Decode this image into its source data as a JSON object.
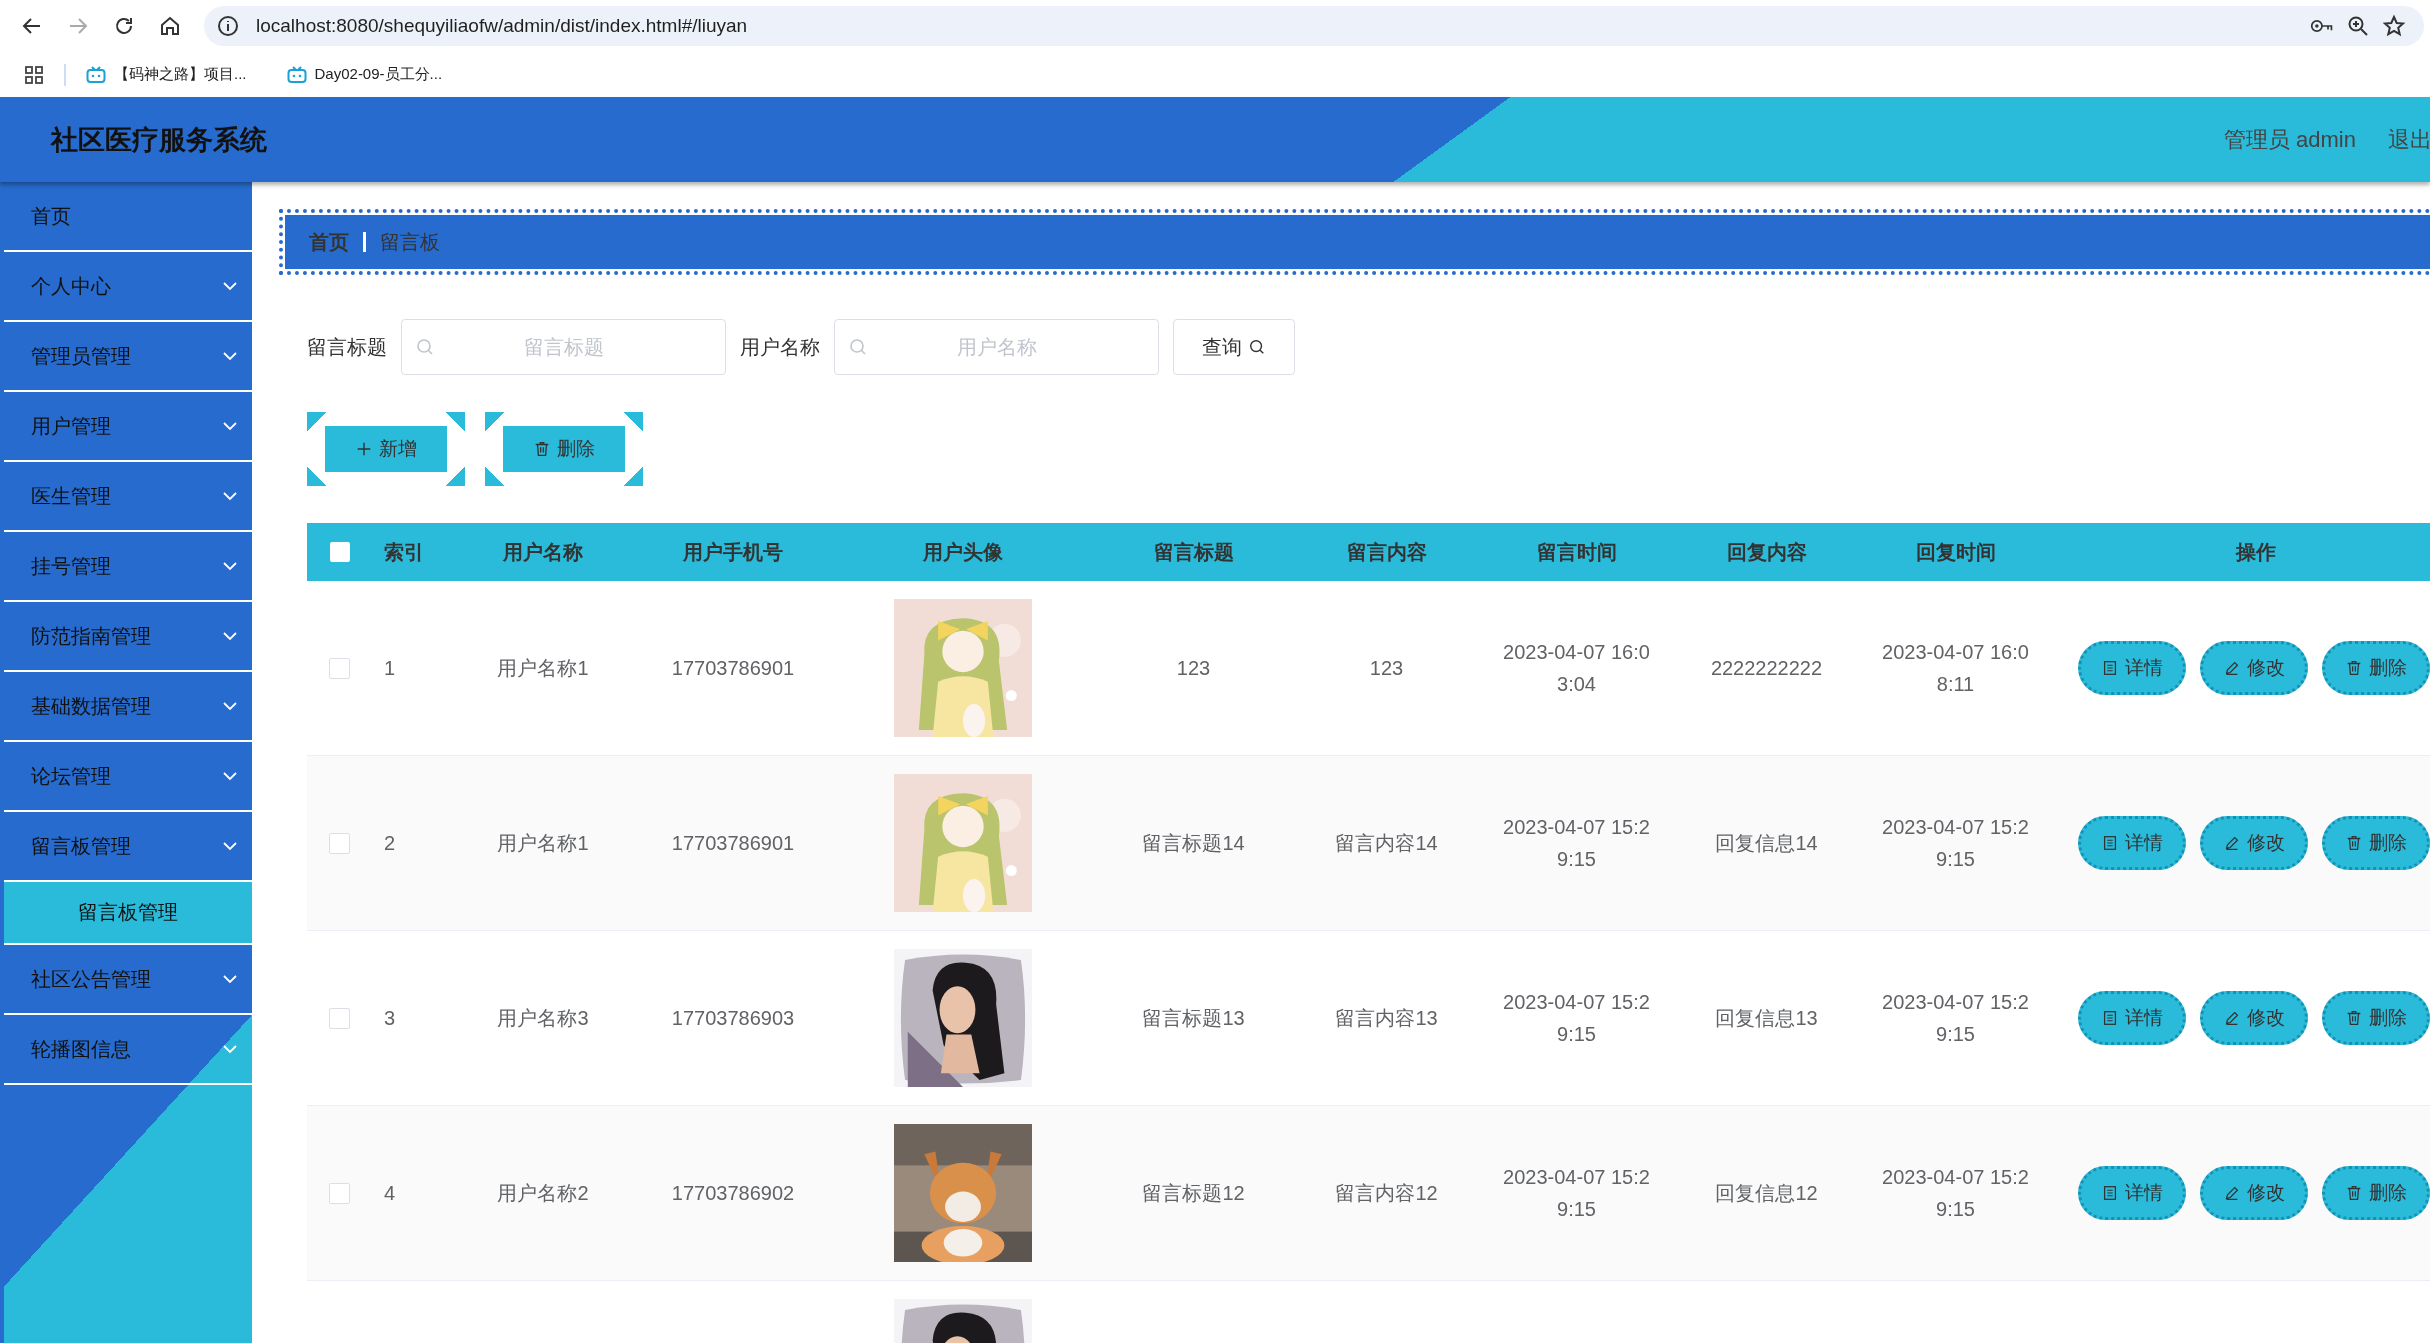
{
  "browser": {
    "url": "localhost:8080/shequyiliaofw/admin/dist/index.html#/liuyan",
    "bookmarks": [
      "【码神之路】项目...",
      "Day02-09-员工分..."
    ]
  },
  "header": {
    "title": "社区医疗服务系统",
    "user": "管理员 admin",
    "logout": "退出"
  },
  "sidebar": {
    "items": [
      {
        "label": "首页",
        "kind": "link"
      },
      {
        "label": "个人中心",
        "kind": "submenu"
      },
      {
        "label": "管理员管理",
        "kind": "submenu"
      },
      {
        "label": "用户管理",
        "kind": "submenu"
      },
      {
        "label": "医生管理",
        "kind": "submenu"
      },
      {
        "label": "挂号管理",
        "kind": "submenu"
      },
      {
        "label": "防范指南管理",
        "kind": "submenu"
      },
      {
        "label": "基础数据管理",
        "kind": "submenu"
      },
      {
        "label": "论坛管理",
        "kind": "submenu"
      },
      {
        "label": "留言板管理",
        "kind": "submenu",
        "children": [
          {
            "label": "留言板管理",
            "selected": true
          }
        ]
      },
      {
        "label": "社区公告管理",
        "kind": "submenu"
      },
      {
        "label": "轮播图信息",
        "kind": "submenu"
      }
    ]
  },
  "breadcrumb": [
    "首页",
    "留言板"
  ],
  "filters": [
    {
      "label": "留言标题",
      "placeholder": "留言标题"
    },
    {
      "label": "用户名称",
      "placeholder": "用户名称"
    }
  ],
  "query_button": "查询",
  "actions": [
    {
      "label": "新增",
      "kind": "add"
    },
    {
      "label": "删除",
      "kind": "delete"
    }
  ],
  "table": {
    "all_checked": false,
    "columns": [
      "索引",
      "用户名称",
      "用户手机号",
      "用户头像",
      "留言标题",
      "留言内容",
      "留言时间",
      "回复内容",
      "回复时间",
      "操作"
    ],
    "rows": [
      {
        "checked": false,
        "index": "1",
        "username": "用户名称1",
        "phone": "17703786901",
        "avatar": {
          "kind": "picture"
        },
        "title": "123",
        "content": "123",
        "time": "2023-04-07 16:03:04",
        "reply": "2222222222",
        "reply_time": "2023-04-07 16:08:11",
        "buttons": [
          {
            "label": "详情",
            "kind": "detail"
          },
          {
            "label": "修改",
            "kind": "edit"
          },
          {
            "label": "删除",
            "kind": "delete"
          }
        ]
      },
      {
        "checked": false,
        "index": "2",
        "username": "用户名称1",
        "phone": "17703786901",
        "avatar": {
          "kind": "picture"
        },
        "title": "留言标题14",
        "content": "留言内容14",
        "time": "2023-04-07 15:29:15",
        "reply": "回复信息14",
        "reply_time": "2023-04-07 15:29:15",
        "buttons": [
          {
            "label": "详情",
            "kind": "detail"
          },
          {
            "label": "修改",
            "kind": "edit"
          },
          {
            "label": "删除",
            "kind": "delete"
          }
        ]
      },
      {
        "checked": false,
        "index": "3",
        "username": "用户名称3",
        "phone": "17703786903",
        "avatar": {
          "kind": "picture"
        },
        "title": "留言标题13",
        "content": "留言内容13",
        "time": "2023-04-07 15:29:15",
        "reply": "回复信息13",
        "reply_time": "2023-04-07 15:29:15",
        "buttons": [
          {
            "label": "详情",
            "kind": "detail"
          },
          {
            "label": "修改",
            "kind": "edit"
          },
          {
            "label": "删除",
            "kind": "delete"
          }
        ]
      },
      {
        "checked": false,
        "index": "4",
        "username": "用户名称2",
        "phone": "17703786902",
        "avatar": {
          "kind": "picture"
        },
        "title": "留言标题12",
        "content": "留言内容12",
        "time": "2023-04-07 15:29:15",
        "reply": "回复信息12",
        "reply_time": "2023-04-07 15:29:15",
        "buttons": [
          {
            "label": "详情",
            "kind": "detail"
          },
          {
            "label": "修改",
            "kind": "edit"
          },
          {
            "label": "删除",
            "kind": "delete"
          }
        ]
      },
      {
        "avatar": {
          "kind": "picture"
        }
      }
    ]
  }
}
